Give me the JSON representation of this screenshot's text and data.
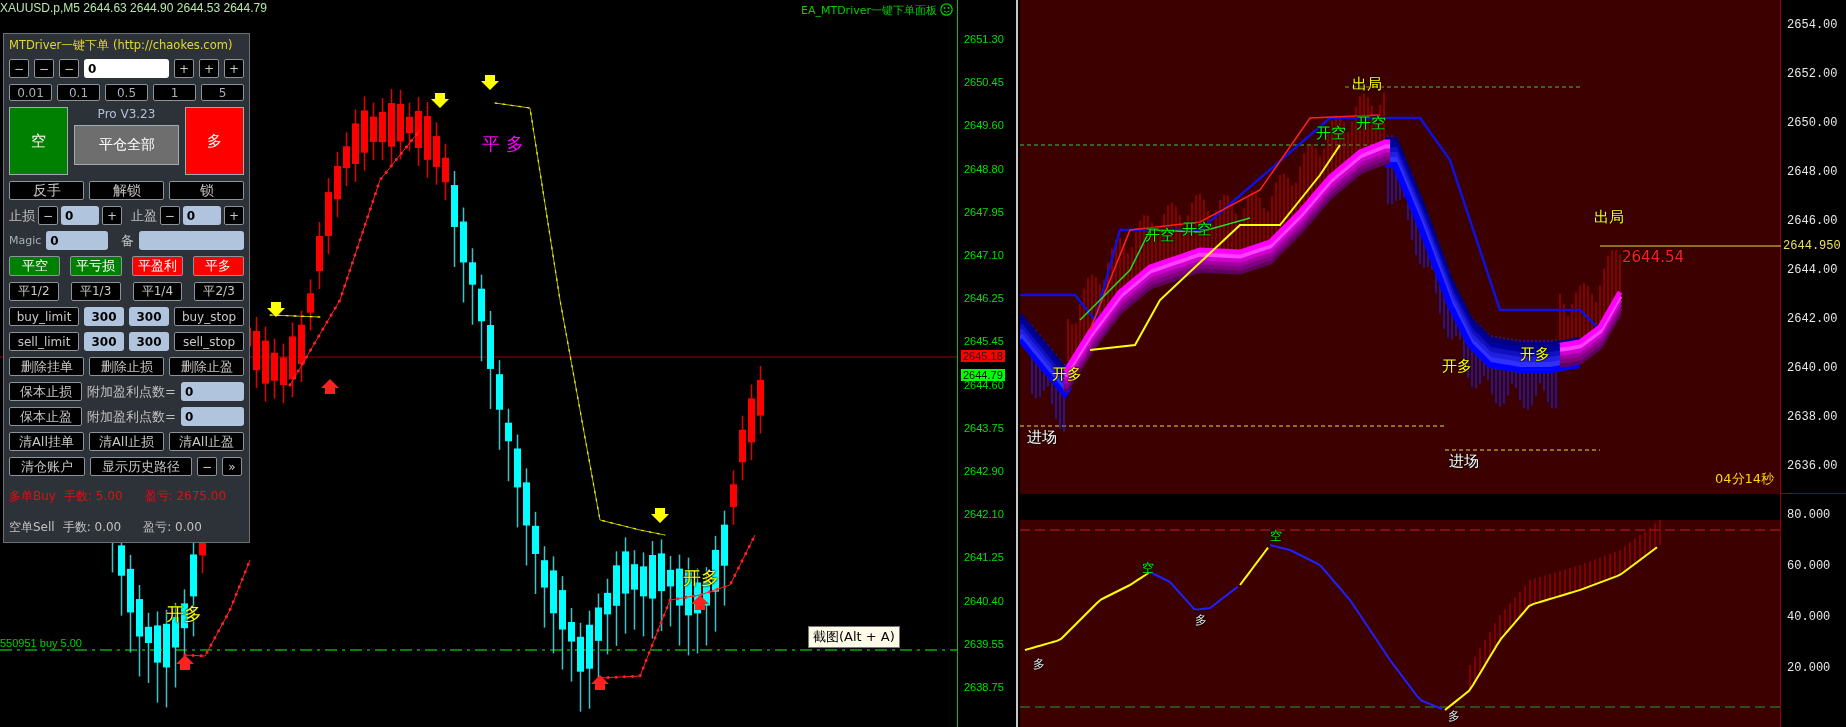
{
  "left_chart": {
    "symbol_line": "XAUUSD.p,M5  2644.63 2644.90 2644.53 2644.79",
    "ea_label": "EA_MTDriver一键下单面板",
    "price_axis": [
      "2651.30",
      "2650.45",
      "2649.60",
      "2648.80",
      "2647.95",
      "2647.10",
      "2646.25",
      "2645.45",
      "2644.60",
      "2643.75",
      "2642.90",
      "2642.10",
      "2641.25",
      "2640.40",
      "2639.55",
      "2638.75"
    ],
    "price_tags": [
      {
        "text": "2645.18",
        "kind": "bid"
      },
      {
        "text": "2644.79",
        "kind": "ask"
      }
    ],
    "order_line": "550951 buy 5.00",
    "annotations": [
      {
        "text": "平 多",
        "kind": "close"
      },
      {
        "text": "开多",
        "kind": "open"
      },
      {
        "text": "开多",
        "kind": "open"
      }
    ],
    "tooltip": "截图(Alt + A)"
  },
  "panel": {
    "title": "MTDriver一键下单 (http://chaokes.com)",
    "minus_buttons": [
      "−",
      "−",
      "−"
    ],
    "lot_input": "0",
    "plus_buttons": [
      "+",
      "+",
      "+"
    ],
    "lot_presets": [
      "0.01",
      "0.1",
      "0.5",
      "1",
      "5"
    ],
    "sell_button": "空",
    "version": "Pro V3.23",
    "close_all_button": "平仓全部",
    "buy_button": "多",
    "action_buttons": [
      "反手",
      "解锁",
      "锁"
    ],
    "stop_loss": {
      "label": "止损",
      "minus": "−",
      "value": "0",
      "plus": "+"
    },
    "take_profit": {
      "label": "止盈",
      "minus": "−",
      "value": "0",
      "plus": "+"
    },
    "magic": {
      "label": "Magic",
      "value": "0"
    },
    "note": {
      "label": "备"
    },
    "close_buttons": [
      {
        "label": "平空",
        "color": "#008000"
      },
      {
        "label": "平亏损",
        "color": "#008000"
      },
      {
        "label": "平盈利",
        "color": "#ff0000"
      },
      {
        "label": "平多",
        "color": "#ff0000"
      }
    ],
    "partial_buttons": [
      "平1/2",
      "平1/3",
      "平1/4",
      "平2/3"
    ],
    "pending_rows": [
      {
        "left": "buy_limit",
        "left_value": "300",
        "right_value": "300",
        "right": "buy_stop"
      },
      {
        "left": "sell_limit",
        "left_value": "300",
        "right_value": "300",
        "right": "sell_stop"
      }
    ],
    "delete_buttons": [
      "删除挂单",
      "删除止损",
      "删除止盈"
    ],
    "breakeven_rows": [
      {
        "button": "保本止损",
        "label": "附加盈利点数=",
        "value": "0"
      },
      {
        "button": "保本止盈",
        "label": "附加盈利点数=",
        "value": "0"
      }
    ],
    "clear_buttons": [
      "清All挂单",
      "清All止损",
      "清All止盈"
    ],
    "bottom_buttons": [
      "清仓账户",
      "显示历史路径",
      "−",
      "»"
    ],
    "positions": [
      {
        "side": "多单Buy",
        "lots": "手数: 5.00",
        "pnl": "盈亏: 2675.00",
        "kind": "buy"
      },
      {
        "side": "空单Sell",
        "lots": "手数: 0.00",
        "pnl": "盈亏: 0.00",
        "kind": "sell"
      }
    ]
  },
  "right_chart": {
    "price_axis": [
      "2654.00",
      "2652.00",
      "2650.00",
      "2648.00",
      "2646.00",
      "2644.00",
      "2642.00",
      "2640.00",
      "2638.00",
      "2636.00"
    ],
    "current_price": "2644.950",
    "osc_axis": [
      "80.000",
      "60.000",
      "40.000",
      "20.000"
    ],
    "timer": "04分14秒",
    "annotations": [
      {
        "text": "出局",
        "kind": "exit"
      },
      {
        "text": "开空",
        "kind": "open_short"
      },
      {
        "text": "开空",
        "kind": "open_short"
      },
      {
        "text": "开空",
        "kind": "open_short"
      },
      {
        "text": "开空",
        "kind": "open_short"
      },
      {
        "text": "出局",
        "kind": "exit"
      },
      {
        "text": "2644.54",
        "kind": "price"
      },
      {
        "text": "开多",
        "kind": "open_long"
      },
      {
        "text": "开多",
        "kind": "open_long"
      },
      {
        "text": "开多",
        "kind": "open_long"
      },
      {
        "text": "进场",
        "kind": "entry"
      },
      {
        "text": "进场",
        "kind": "entry"
      }
    ],
    "osc_marks": [
      {
        "text": "空",
        "kind": "short"
      },
      {
        "text": "空",
        "kind": "short"
      },
      {
        "text": "多",
        "kind": "long"
      },
      {
        "text": "多",
        "kind": "long"
      },
      {
        "text": "多",
        "kind": "long"
      }
    ]
  }
}
